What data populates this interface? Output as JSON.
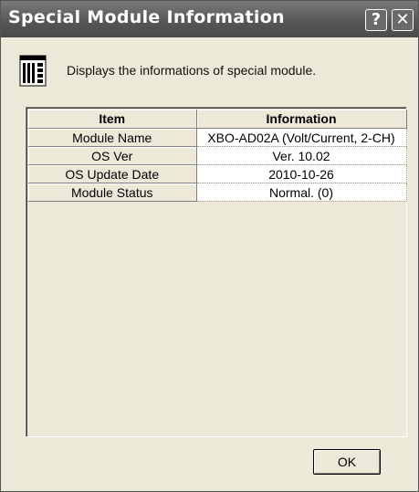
{
  "window": {
    "title": "Special Module Information",
    "help_label": "?",
    "close_label": "✕"
  },
  "header": {
    "icon": "module-rack-icon",
    "description": "Displays the informations of special module."
  },
  "table": {
    "columns": [
      "Item",
      "Information"
    ],
    "rows": [
      {
        "item": "Module Name",
        "value": "XBO-AD02A (Volt/Current, 2-CH)"
      },
      {
        "item": "OS Ver",
        "value": "Ver. 10.02"
      },
      {
        "item": "OS Update Date",
        "value": "2010-10-26"
      },
      {
        "item": "Module Status",
        "value": "Normal. (0)"
      }
    ]
  },
  "footer": {
    "ok_label": "OK"
  },
  "colors": {
    "titlebar": "#555555",
    "face": "#ece9d8",
    "cell_bg": "#ffffff"
  }
}
